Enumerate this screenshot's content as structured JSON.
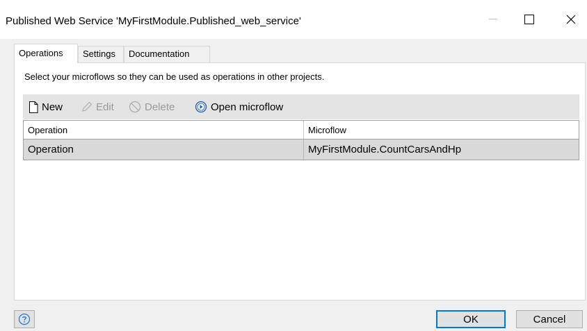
{
  "window": {
    "title": "Published Web Service 'MyFirstModule.Published_web_service'",
    "controls": [
      "minimize",
      "maximize",
      "close"
    ]
  },
  "tabs": [
    {
      "label": "Operations",
      "active": true
    },
    {
      "label": "Settings",
      "active": false
    },
    {
      "label": "Documentation",
      "active": false
    }
  ],
  "operations": {
    "description": "Select your microflows so they can be used as operations in other projects.",
    "toolbar": {
      "new_label": "New",
      "edit_label": "Edit",
      "delete_label": "Delete",
      "open_label": "Open microflow"
    },
    "table": {
      "columns": [
        "Operation",
        "Microflow"
      ],
      "rows": [
        [
          "Operation",
          "MyFirstModule.CountCarsAndHp"
        ]
      ]
    }
  },
  "footer": {
    "help_icon": "question-circle-icon",
    "ok_label": "OK",
    "cancel_label": "Cancel"
  },
  "colors": {
    "accent": "#0078d7",
    "selected_row": "#d9d9d9",
    "toolbar": "#e4e4e4",
    "disabled_text": "#9a9a9a"
  }
}
